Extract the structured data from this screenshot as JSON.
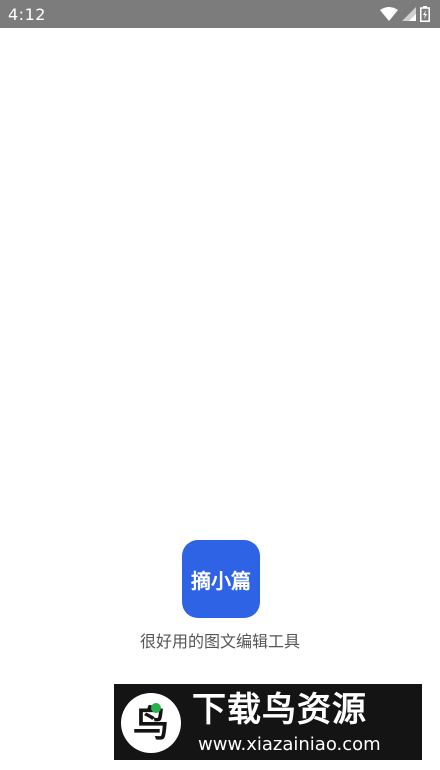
{
  "status_bar": {
    "time": "4:12",
    "icons": [
      "wifi-icon",
      "cell-signal-icon",
      "battery-icon"
    ],
    "background": "#7c7c7c"
  },
  "splash": {
    "logo_text": "摘小篇",
    "logo_color": "#2f63e6",
    "tagline": "很好用的图文编辑工具"
  },
  "watermark": {
    "title": "下载鸟资源",
    "url": "www.xiazainiao.com",
    "emblem_text": "鸟"
  }
}
